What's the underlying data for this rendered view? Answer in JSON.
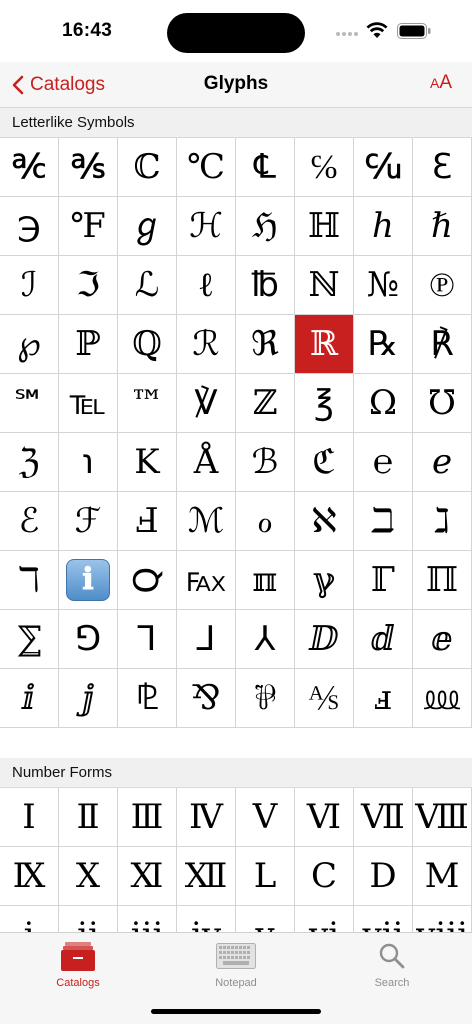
{
  "status": {
    "time": "16:43"
  },
  "nav": {
    "back_label": "Catalogs",
    "title": "Glyphs",
    "font_size_small": "A",
    "font_size_big": "A"
  },
  "sections": [
    {
      "title": "Letterlike Symbols",
      "glyphs": [
        "℀",
        "℁",
        "ℂ",
        "℃",
        "℄",
        "℅",
        "℆",
        "ℇ",
        "℈",
        "℉",
        "ℊ",
        "ℋ",
        "ℌ",
        "ℍ",
        "ℎ",
        "ℏ",
        "ℐ",
        "ℑ",
        "ℒ",
        "ℓ",
        "℔",
        "ℕ",
        "№",
        "℗",
        "℘",
        "ℙ",
        "ℚ",
        "ℛ",
        "ℜ",
        "ℝ",
        "℞",
        "℟",
        "℠",
        "℡",
        "™",
        "℣",
        "ℤ",
        "℥",
        "Ω",
        "℧",
        "ℨ",
        "℩",
        "K",
        "Å",
        "ℬ",
        "ℭ",
        "℮",
        "ℯ",
        "ℰ",
        "ℱ",
        "Ⅎ",
        "ℳ",
        "ℴ",
        "ℵ",
        "ℶ",
        "ℷ",
        "ℸ",
        "ℹ",
        "℺",
        "℻",
        "ℼ",
        "ℽ",
        "ℾ",
        "ℿ",
        "⅀",
        "⅁",
        "⅂",
        "⅃",
        "⅄",
        "ⅅ",
        "ⅆ",
        "ⅇ",
        "ⅈ",
        "ⅉ",
        "⅊",
        "⅋",
        "⅌",
        "⅍",
        "ⅎ",
        "⅏"
      ]
    },
    {
      "title": "Number Forms",
      "glyphs": [
        "Ⅰ",
        "Ⅱ",
        "Ⅲ",
        "Ⅳ",
        "Ⅴ",
        "Ⅵ",
        "Ⅶ",
        "Ⅷ",
        "Ⅸ",
        "Ⅹ",
        "Ⅺ",
        "Ⅻ",
        "Ⅼ",
        "Ⅽ",
        "Ⅾ",
        "Ⅿ",
        "ⅰ",
        "ⅱ",
        "ⅲ",
        "ⅳ",
        "ⅴ",
        "ⅵ",
        "ⅶ",
        "ⅷ"
      ]
    }
  ],
  "selected_glyph": "ℝ",
  "tabs": [
    {
      "label": "Catalogs",
      "icon": "catalogs-icon",
      "active": true
    },
    {
      "label": "Notepad",
      "icon": "notepad-icon",
      "active": false
    },
    {
      "label": "Search",
      "icon": "search-icon",
      "active": false
    }
  ],
  "colors": {
    "accent": "#c8201e",
    "inactive": "#8e8e93"
  }
}
